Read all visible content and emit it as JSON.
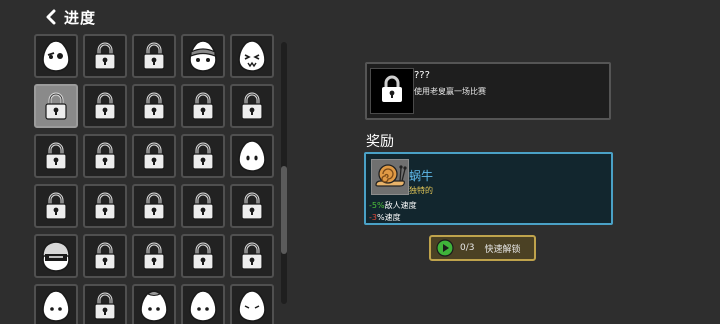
{
  "header": {
    "title": "进度",
    "back_icon": "chevron-left-icon"
  },
  "grid": {
    "cells": [
      [
        "egg-winking",
        "lock",
        "lock",
        "egg-bandana",
        "egg-fangs"
      ],
      [
        "lock-selected",
        "lock",
        "lock",
        "lock",
        "lock"
      ],
      [
        "lock",
        "lock",
        "lock",
        "lock",
        "egg-plain"
      ],
      [
        "lock",
        "lock",
        "lock",
        "lock",
        "lock"
      ],
      [
        "egg-helmet",
        "lock",
        "lock",
        "lock",
        "lock"
      ],
      [
        "egg-partial",
        "lock",
        "egg-partial-leaf",
        "egg-partial",
        "egg-partial-face"
      ]
    ]
  },
  "achievement": {
    "title": "???",
    "description": "使用老叟赢一场比赛",
    "icon": "lock-icon"
  },
  "reward": {
    "label": "奖励",
    "name": "蜗牛",
    "rarity": "独特的",
    "icon": "snail-icon",
    "stats": [
      {
        "value": "-5%",
        "text": "敌人速度",
        "tone": "good"
      },
      {
        "value": "-3",
        "text": "%速度",
        "tone": "bad"
      }
    ]
  },
  "unlock_button": {
    "count": "0/3",
    "label": "快速解锁",
    "icon": "play-icon"
  },
  "colors": {
    "background": "#2e2e2e",
    "reward_border": "#4aa1c6",
    "reward_name": "#5fb9ea",
    "rarity": "#e3c657",
    "positive": "#4ec03a",
    "negative": "#e24a3a",
    "button_border": "#bfa34c"
  }
}
